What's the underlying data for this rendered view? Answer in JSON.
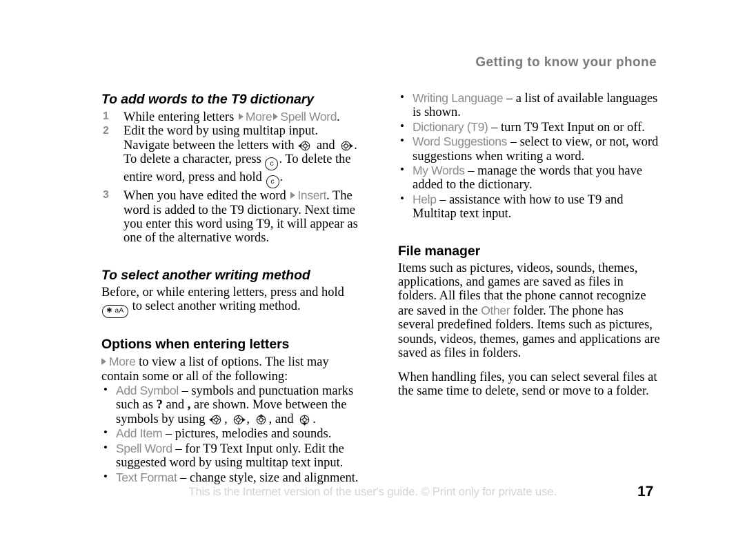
{
  "header": {
    "running_title": "Getting to know your phone"
  },
  "left_column": {
    "section1": {
      "heading": "To add words to the T9 dictionary",
      "steps": [
        {
          "number": "1",
          "parts": [
            {
              "t": "text",
              "v": "While entering letters "
            },
            {
              "t": "tri"
            },
            {
              "t": "ui",
              "v": "More"
            },
            {
              "t": "tri"
            },
            {
              "t": "ui",
              "v": "Spell Word"
            },
            {
              "t": "text",
              "v": "."
            }
          ]
        },
        {
          "number": "2",
          "parts": [
            {
              "t": "text",
              "v": "Edit the word by using multitap input. Navigate between the letters with "
            },
            {
              "t": "nav",
              "v": "nav-left"
            },
            {
              "t": "text",
              "v": " and "
            },
            {
              "t": "nav",
              "v": "nav-right"
            },
            {
              "t": "text",
              "v": ". To delete a character, press "
            },
            {
              "t": "key-c",
              "v": "c"
            },
            {
              "t": "text",
              "v": ". To delete the entire word, press and hold "
            },
            {
              "t": "key-c",
              "v": "c"
            },
            {
              "t": "text",
              "v": "."
            }
          ]
        },
        {
          "number": "3",
          "parts": [
            {
              "t": "text",
              "v": "When you have edited the word "
            },
            {
              "t": "tri"
            },
            {
              "t": "ui",
              "v": "Insert"
            },
            {
              "t": "text",
              "v": ". The word is added to the T9 dictionary. Next time you enter this word using T9, it will appear as one of the alternative words."
            }
          ]
        }
      ]
    },
    "section2": {
      "heading": "To select another writing method",
      "paragraph_parts": [
        {
          "t": "text",
          "v": "Before, or while entering letters, press and hold "
        },
        {
          "t": "key-star",
          "v": "✱ aA"
        },
        {
          "t": "text",
          "v": " to select another writing method."
        }
      ]
    },
    "section3": {
      "heading": "Options when entering letters",
      "intro_parts": [
        {
          "t": "tri-lead"
        },
        {
          "t": "ui",
          "v": "More"
        },
        {
          "t": "text",
          "v": " to view a list of options. The list may contain some or all of the following:"
        }
      ],
      "bullets": [
        {
          "parts": [
            {
              "t": "ui",
              "v": "Add Symbol"
            },
            {
              "t": "text",
              "v": " – symbols and punctuation marks such as "
            },
            {
              "t": "bold",
              "v": "?"
            },
            {
              "t": "text",
              "v": " and "
            },
            {
              "t": "bold",
              "v": ","
            },
            {
              "t": "text",
              "v": " are shown. Move between the symbols by using "
            },
            {
              "t": "nav",
              "v": "nav-left"
            },
            {
              "t": "text",
              "v": ", "
            },
            {
              "t": "nav",
              "v": "nav-right"
            },
            {
              "t": "text",
              "v": ", "
            },
            {
              "t": "nav",
              "v": "nav-up"
            },
            {
              "t": "text",
              "v": ", and "
            },
            {
              "t": "nav",
              "v": "nav-down"
            },
            {
              "t": "text",
              "v": "."
            }
          ]
        },
        {
          "parts": [
            {
              "t": "ui",
              "v": "Add Item"
            },
            {
              "t": "text",
              "v": " – pictures, melodies and sounds."
            }
          ]
        },
        {
          "parts": [
            {
              "t": "ui",
              "v": "Spell Word"
            },
            {
              "t": "text",
              "v": " – for T9 Text Input only. Edit the suggested word by using multitap text input."
            }
          ]
        },
        {
          "parts": [
            {
              "t": "ui",
              "v": "Text Format"
            },
            {
              "t": "text",
              "v": " – change style, size and alignment."
            }
          ]
        }
      ]
    }
  },
  "right_column": {
    "settings_bullets": [
      {
        "parts": [
          {
            "t": "ui",
            "v": "Writing Language"
          },
          {
            "t": "text",
            "v": " – a list of available languages is shown."
          }
        ]
      },
      {
        "parts": [
          {
            "t": "ui",
            "v": "Dictionary (T9)"
          },
          {
            "t": "text",
            "v": " – turn T9 Text Input on or off."
          }
        ]
      },
      {
        "parts": [
          {
            "t": "ui",
            "v": "Word Suggestions"
          },
          {
            "t": "text",
            "v": " – select to view, or not, word suggestions when writing a word."
          }
        ]
      },
      {
        "parts": [
          {
            "t": "ui",
            "v": "My Words"
          },
          {
            "t": "text",
            "v": " – manage the words that you have added to the dictionary."
          }
        ]
      },
      {
        "parts": [
          {
            "t": "ui",
            "v": "Help"
          },
          {
            "t": "text",
            "v": " – assistance with how to use T9 and Multitap text input."
          }
        ]
      }
    ],
    "file_manager": {
      "heading": "File manager",
      "paragraph1_parts": [
        {
          "t": "text",
          "v": "Items such as pictures, videos, sounds, themes, applications, and games are saved as files in folders. All files that the phone cannot recognize are saved in the "
        },
        {
          "t": "ui",
          "v": "Other"
        },
        {
          "t": "text",
          "v": " folder. The phone has several predefined folders. Items such as pictures, sounds, videos, themes, games and applications are saved as files in folders."
        }
      ],
      "paragraph2": "When handling files, you can select several files at the same time to delete, send or move to a folder."
    }
  },
  "footer": {
    "text": "This is the Internet version of the user's guide. © Print only for private use.",
    "page_number": "17"
  },
  "colors": {
    "ui_term_gray": "#8c8c8c",
    "header_gray": "#7b7b7b",
    "footer_gray": "#d4d4d4",
    "body_black": "#000000"
  }
}
